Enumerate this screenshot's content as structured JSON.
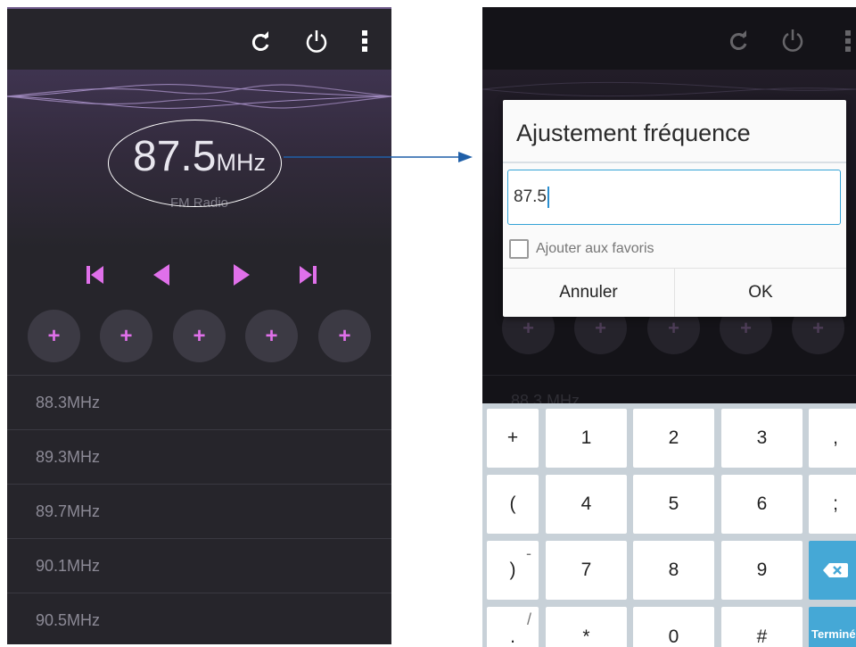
{
  "left_screen": {
    "frequency_value": "87.5",
    "frequency_unit": "MHz",
    "source_label": "FM Radio",
    "action_icons": [
      "refresh-icon",
      "power-icon",
      "more-vert-icon"
    ],
    "controls": [
      "skip-previous-icon",
      "seek-back-icon",
      "seek-forward-icon",
      "skip-next-icon"
    ],
    "presets": [
      "+",
      "+",
      "+",
      "+",
      "+"
    ],
    "stations": [
      {
        "value": "88.3",
        "unit": "MHz"
      },
      {
        "value": "89.3",
        "unit": "MHz"
      },
      {
        "value": "89.7",
        "unit": "MHz"
      },
      {
        "value": "90.1",
        "unit": "MHz"
      },
      {
        "value": "90.5",
        "unit": "MHz"
      }
    ]
  },
  "right_screen": {
    "dimmed_presets": [
      "+",
      "+",
      "+",
      "+",
      "+"
    ],
    "dimmed_station": "88.3 MHz",
    "dialog": {
      "title": "Ajustement fréquence",
      "input_value": "87.5",
      "checkbox_label": "Ajouter aux favoris",
      "checkbox_checked": false,
      "cancel_label": "Annuler",
      "ok_label": "OK"
    },
    "keyboard": {
      "rows": [
        [
          {
            "label": "+"
          },
          {
            "label": "1"
          },
          {
            "label": "2"
          },
          {
            "label": "3"
          },
          {
            "label": ","
          }
        ],
        [
          {
            "label": "("
          },
          {
            "label": "4"
          },
          {
            "label": "5"
          },
          {
            "label": "6"
          },
          {
            "label": ";"
          }
        ],
        [
          {
            "label": ")",
            "alt": "-"
          },
          {
            "label": "7"
          },
          {
            "label": "8"
          },
          {
            "label": "9"
          },
          {
            "label": "backspace-icon"
          }
        ],
        [
          {
            "label": ".",
            "alt": "/"
          },
          {
            "label": "*"
          },
          {
            "label": "0"
          },
          {
            "label": "#"
          },
          {
            "label": "Terminé"
          }
        ]
      ]
    }
  },
  "colors": {
    "accent_pink": "#e070ea",
    "input_border": "#34a3d6",
    "key_blue": "#45a8d6",
    "arrow_blue": "#1f5fa8"
  }
}
